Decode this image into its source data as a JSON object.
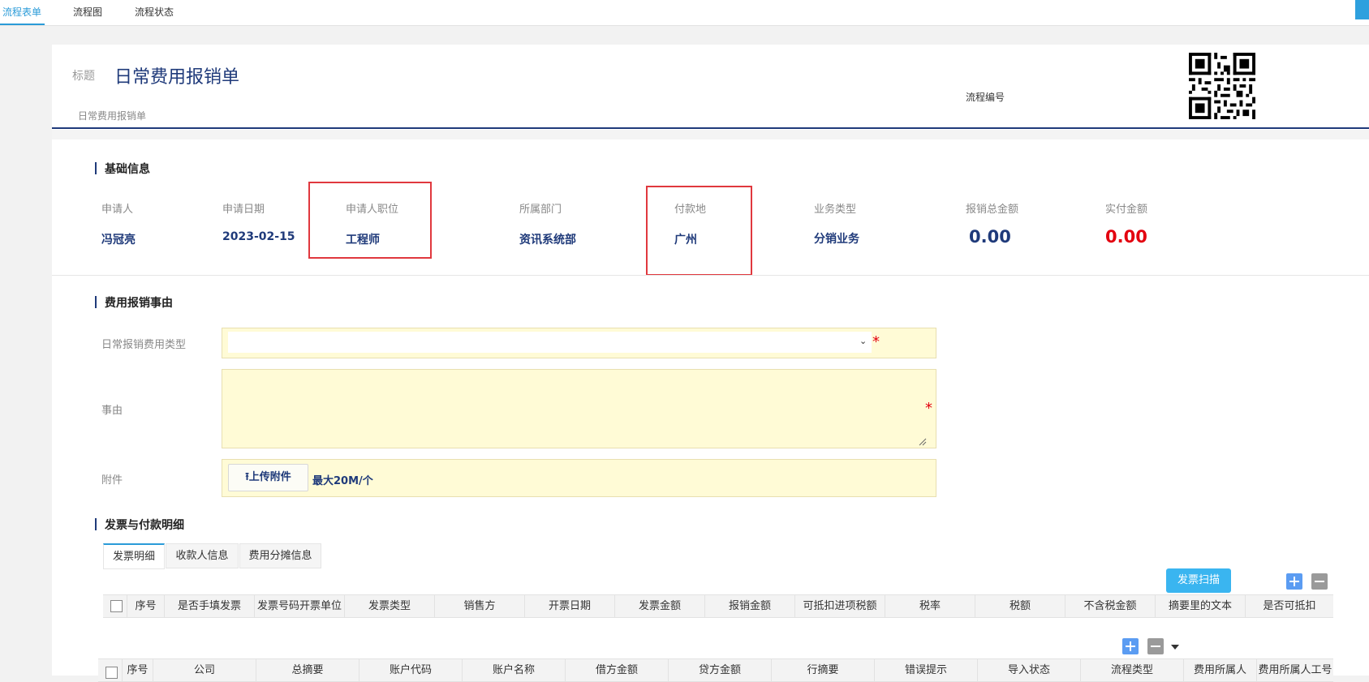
{
  "tabs": [
    "流程表单",
    "流程图",
    "流程状态"
  ],
  "header": {
    "title_label": "标题",
    "title": "日常费用报销单",
    "subtitle": "日常费用报销单",
    "flow_no_label": "流程编号"
  },
  "basic": {
    "section": "基础信息",
    "fields": [
      {
        "label": "申请人",
        "value": "冯冠亮"
      },
      {
        "label": "申请日期",
        "value": "2023-02-15"
      },
      {
        "label": "申请人职位",
        "value": "工程师"
      },
      {
        "label": "所属部门",
        "value": "资讯系统部"
      },
      {
        "label": "付款地",
        "value": "广州"
      },
      {
        "label": "业务类型",
        "value": "分销业务"
      },
      {
        "label": "报销总金额",
        "value": "0.00"
      },
      {
        "label": "实付金额",
        "value": "0.00"
      }
    ]
  },
  "reason": {
    "section": "费用报销事由",
    "type_label": "日常报销费用类型",
    "reason_label": "事由",
    "attach_label": "附件",
    "upload_label": "⭱上传附件",
    "upload_hint": "最大20M/个",
    "required_mark": "*"
  },
  "invoice": {
    "section": "发票与付款明细",
    "subtabs": [
      "发票明细",
      "收款人信息",
      "费用分摊信息"
    ],
    "scan_label": "发票扫描",
    "table1_headers": [
      "序号",
      "是否手填发票",
      "发票号码开票单位",
      "发票类型",
      "销售方",
      "开票日期",
      "发票金额",
      "报销金额",
      "可抵扣进项税额",
      "税率",
      "税额",
      "不含税金额",
      "摘要里的文本",
      "是否可抵扣"
    ],
    "table2_headers": [
      "序号",
      "公司",
      "总摘要",
      "账户代码",
      "账户名称",
      "借方金额",
      "贷方金额",
      "行摘要",
      "错误提示",
      "导入状态",
      "流程类型",
      "费用所属人",
      "费用所属人工号"
    ]
  },
  "colors": {
    "accent": "#2a9bd8",
    "navy": "#1f3a7a",
    "required": "#e3000f",
    "field_bg": "#fffbd6",
    "annotation_box": "#e0383e"
  }
}
